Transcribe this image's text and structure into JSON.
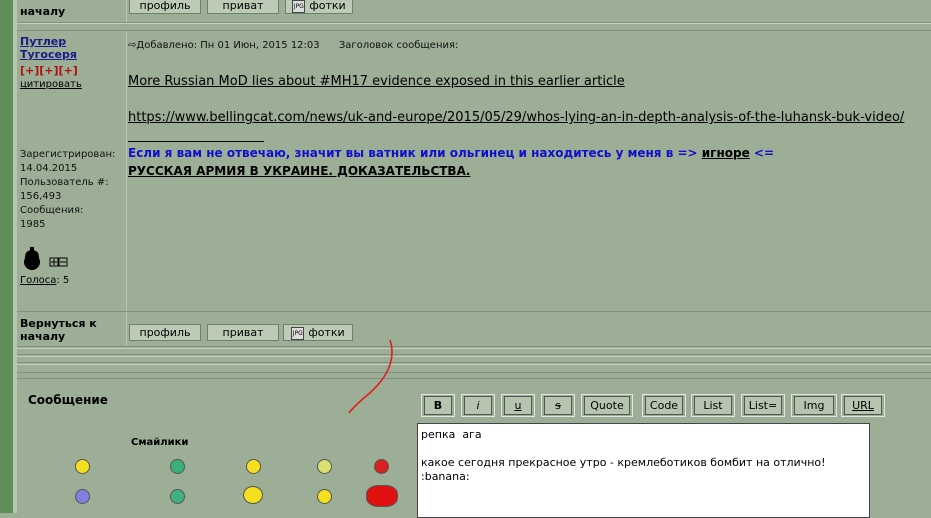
{
  "top_row": {
    "back_label": "началу",
    "buttons": [
      "профиль",
      "приват",
      "фотки"
    ]
  },
  "post": {
    "author": {
      "name_line1": "Путлер",
      "name_line2": "Тугосеря",
      "plus": "[+][+][+]",
      "quote_label": "цитировать",
      "registered_label": "Зарегистрирован:",
      "registered_date": "14.04.2015",
      "user_no_label": "Пользователь #:",
      "user_no": "156,493",
      "messages_label": "Сообщения:",
      "messages_count": "1985",
      "votes_label": "Голоса",
      "votes_value": ": 5"
    },
    "header": {
      "added": "Добавлено: Пн 01 Июн, 2015 12:03",
      "subject_label": "Заголовок сообщения:"
    },
    "body": {
      "line1": "More Russian MoD lies about #MH17 evidence exposed in this earlier article",
      "line2": "https://www.bellingcat.com/news/uk-and-europe/2015/05/29/whos-lying-an-in-depth-analysis-of-the-luhansk-buk-video/",
      "sig_part1": "Если я вам не отвечаю, значит вы ватник или ольгинец и находитесь у меня в =>",
      "sig_ignore": "игноре",
      "sig_part2": "<=",
      "sig_line2": "РУССКАЯ АРМИЯ В УКРАИНЕ. ДОКАЗАТЕЛЬСТВА."
    }
  },
  "bottom_row": {
    "back_label_line1": "Вернуться к",
    "back_label_line2": "началу",
    "buttons": [
      "профиль",
      "приват",
      "фотки"
    ]
  },
  "editor": {
    "message_label": "Сообщение",
    "smilies_label": "Смайлики",
    "toolbar": [
      "B",
      "i",
      "u",
      "s",
      "Quote",
      "Code",
      "List",
      "List=",
      "Img",
      "URL"
    ],
    "text": "репка  ага\n\nкакое сегодня прекрасное утро - кремлеботиков бомбит на отлично!\n:banana:"
  },
  "colors": {
    "bg": "#9dae96",
    "accent_strip": "#5f8f5a",
    "annotation_stroke": "#e02020"
  }
}
